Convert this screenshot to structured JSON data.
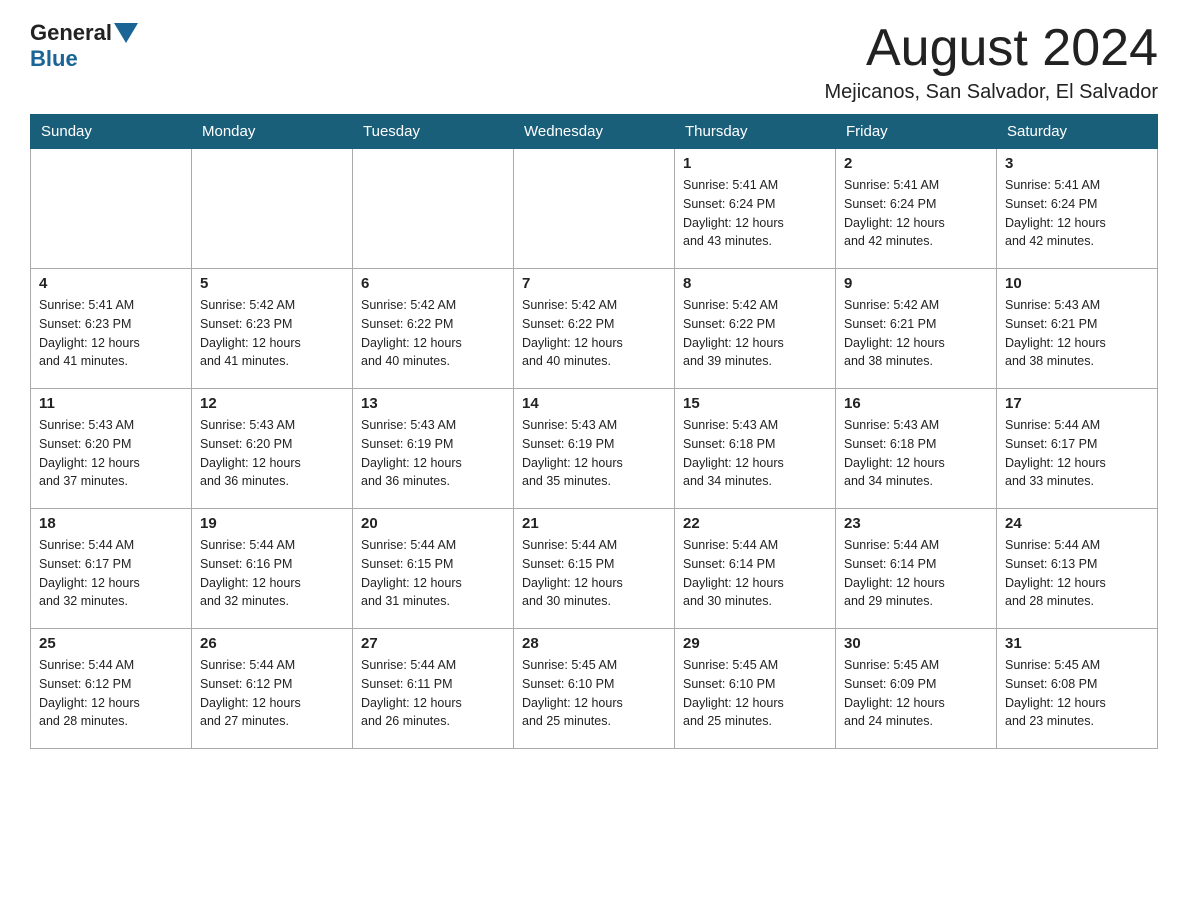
{
  "header": {
    "logo_general": "General",
    "logo_blue": "Blue",
    "title": "August 2024",
    "subtitle": "Mejicanos, San Salvador, El Salvador"
  },
  "days_of_week": [
    "Sunday",
    "Monday",
    "Tuesday",
    "Wednesday",
    "Thursday",
    "Friday",
    "Saturday"
  ],
  "weeks": [
    [
      {
        "day": "",
        "info": ""
      },
      {
        "day": "",
        "info": ""
      },
      {
        "day": "",
        "info": ""
      },
      {
        "day": "",
        "info": ""
      },
      {
        "day": "1",
        "info": "Sunrise: 5:41 AM\nSunset: 6:24 PM\nDaylight: 12 hours\nand 43 minutes."
      },
      {
        "day": "2",
        "info": "Sunrise: 5:41 AM\nSunset: 6:24 PM\nDaylight: 12 hours\nand 42 minutes."
      },
      {
        "day": "3",
        "info": "Sunrise: 5:41 AM\nSunset: 6:24 PM\nDaylight: 12 hours\nand 42 minutes."
      }
    ],
    [
      {
        "day": "4",
        "info": "Sunrise: 5:41 AM\nSunset: 6:23 PM\nDaylight: 12 hours\nand 41 minutes."
      },
      {
        "day": "5",
        "info": "Sunrise: 5:42 AM\nSunset: 6:23 PM\nDaylight: 12 hours\nand 41 minutes."
      },
      {
        "day": "6",
        "info": "Sunrise: 5:42 AM\nSunset: 6:22 PM\nDaylight: 12 hours\nand 40 minutes."
      },
      {
        "day": "7",
        "info": "Sunrise: 5:42 AM\nSunset: 6:22 PM\nDaylight: 12 hours\nand 40 minutes."
      },
      {
        "day": "8",
        "info": "Sunrise: 5:42 AM\nSunset: 6:22 PM\nDaylight: 12 hours\nand 39 minutes."
      },
      {
        "day": "9",
        "info": "Sunrise: 5:42 AM\nSunset: 6:21 PM\nDaylight: 12 hours\nand 38 minutes."
      },
      {
        "day": "10",
        "info": "Sunrise: 5:43 AM\nSunset: 6:21 PM\nDaylight: 12 hours\nand 38 minutes."
      }
    ],
    [
      {
        "day": "11",
        "info": "Sunrise: 5:43 AM\nSunset: 6:20 PM\nDaylight: 12 hours\nand 37 minutes."
      },
      {
        "day": "12",
        "info": "Sunrise: 5:43 AM\nSunset: 6:20 PM\nDaylight: 12 hours\nand 36 minutes."
      },
      {
        "day": "13",
        "info": "Sunrise: 5:43 AM\nSunset: 6:19 PM\nDaylight: 12 hours\nand 36 minutes."
      },
      {
        "day": "14",
        "info": "Sunrise: 5:43 AM\nSunset: 6:19 PM\nDaylight: 12 hours\nand 35 minutes."
      },
      {
        "day": "15",
        "info": "Sunrise: 5:43 AM\nSunset: 6:18 PM\nDaylight: 12 hours\nand 34 minutes."
      },
      {
        "day": "16",
        "info": "Sunrise: 5:43 AM\nSunset: 6:18 PM\nDaylight: 12 hours\nand 34 minutes."
      },
      {
        "day": "17",
        "info": "Sunrise: 5:44 AM\nSunset: 6:17 PM\nDaylight: 12 hours\nand 33 minutes."
      }
    ],
    [
      {
        "day": "18",
        "info": "Sunrise: 5:44 AM\nSunset: 6:17 PM\nDaylight: 12 hours\nand 32 minutes."
      },
      {
        "day": "19",
        "info": "Sunrise: 5:44 AM\nSunset: 6:16 PM\nDaylight: 12 hours\nand 32 minutes."
      },
      {
        "day": "20",
        "info": "Sunrise: 5:44 AM\nSunset: 6:15 PM\nDaylight: 12 hours\nand 31 minutes."
      },
      {
        "day": "21",
        "info": "Sunrise: 5:44 AM\nSunset: 6:15 PM\nDaylight: 12 hours\nand 30 minutes."
      },
      {
        "day": "22",
        "info": "Sunrise: 5:44 AM\nSunset: 6:14 PM\nDaylight: 12 hours\nand 30 minutes."
      },
      {
        "day": "23",
        "info": "Sunrise: 5:44 AM\nSunset: 6:14 PM\nDaylight: 12 hours\nand 29 minutes."
      },
      {
        "day": "24",
        "info": "Sunrise: 5:44 AM\nSunset: 6:13 PM\nDaylight: 12 hours\nand 28 minutes."
      }
    ],
    [
      {
        "day": "25",
        "info": "Sunrise: 5:44 AM\nSunset: 6:12 PM\nDaylight: 12 hours\nand 28 minutes."
      },
      {
        "day": "26",
        "info": "Sunrise: 5:44 AM\nSunset: 6:12 PM\nDaylight: 12 hours\nand 27 minutes."
      },
      {
        "day": "27",
        "info": "Sunrise: 5:44 AM\nSunset: 6:11 PM\nDaylight: 12 hours\nand 26 minutes."
      },
      {
        "day": "28",
        "info": "Sunrise: 5:45 AM\nSunset: 6:10 PM\nDaylight: 12 hours\nand 25 minutes."
      },
      {
        "day": "29",
        "info": "Sunrise: 5:45 AM\nSunset: 6:10 PM\nDaylight: 12 hours\nand 25 minutes."
      },
      {
        "day": "30",
        "info": "Sunrise: 5:45 AM\nSunset: 6:09 PM\nDaylight: 12 hours\nand 24 minutes."
      },
      {
        "day": "31",
        "info": "Sunrise: 5:45 AM\nSunset: 6:08 PM\nDaylight: 12 hours\nand 23 minutes."
      }
    ]
  ]
}
